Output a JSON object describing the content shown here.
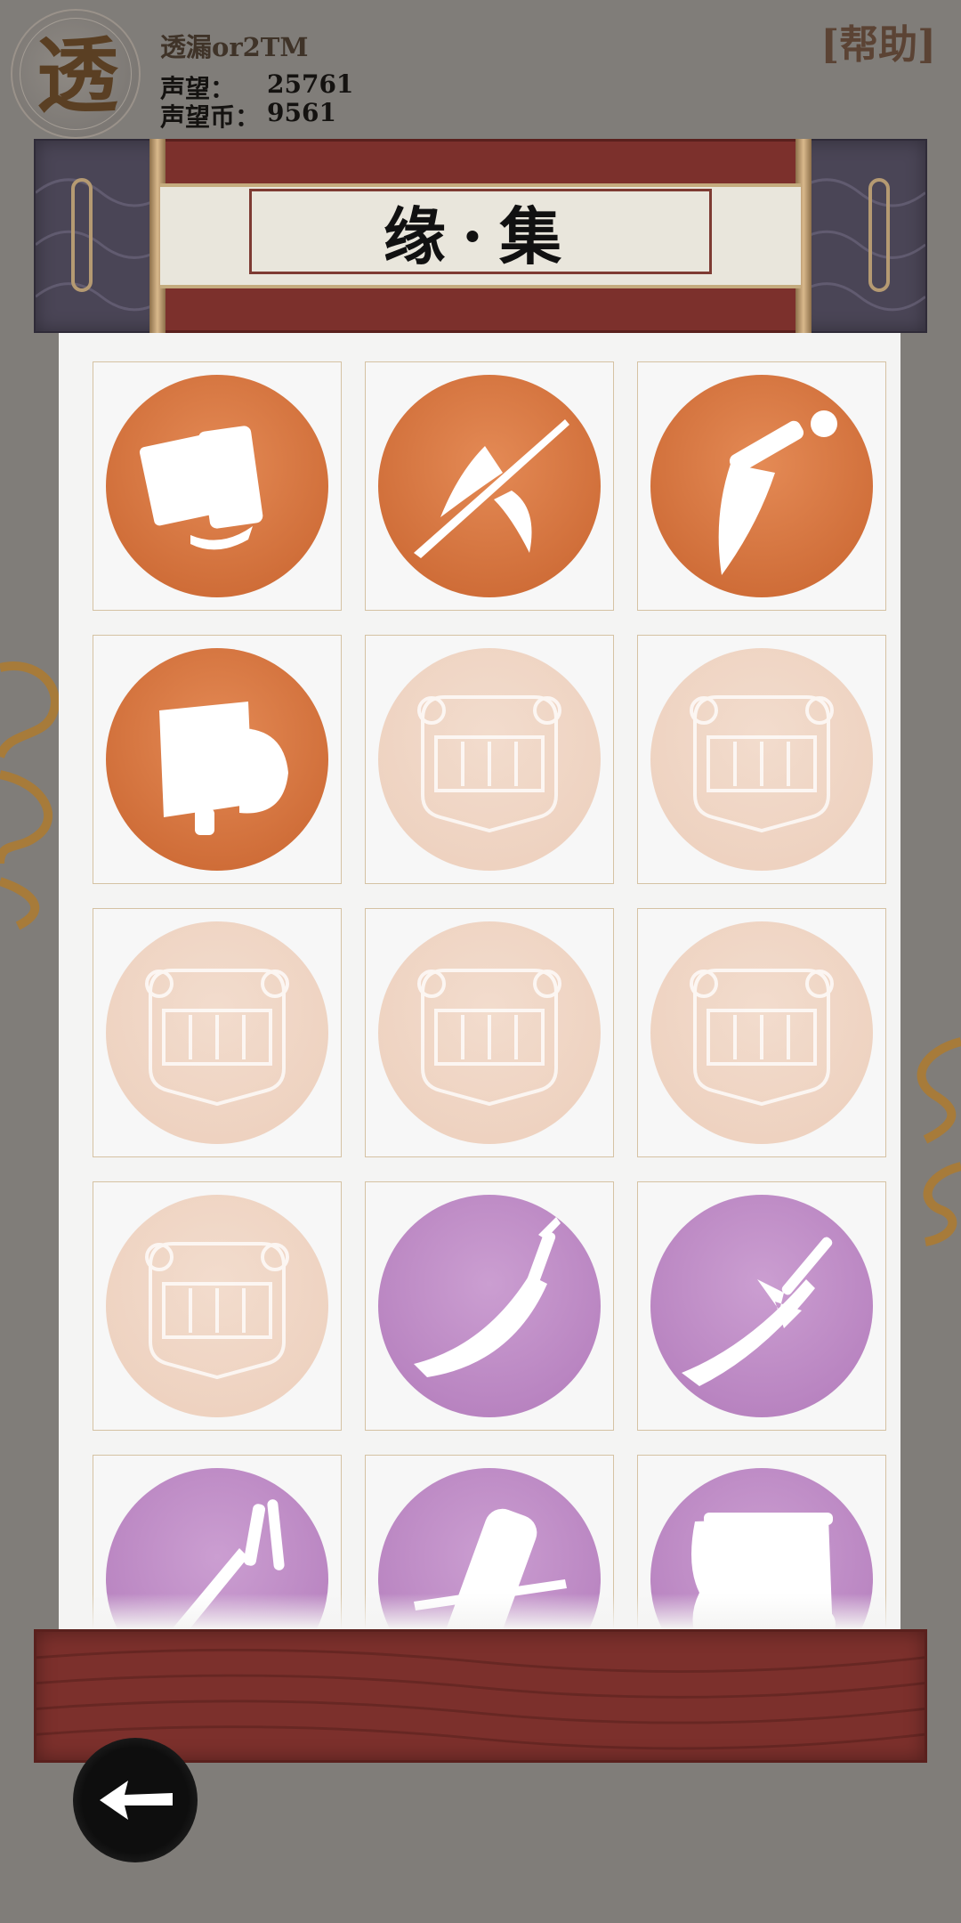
{
  "player": {
    "avatar_glyph": "透",
    "name": "透漏or2TM",
    "reputation_label": "声望：",
    "reputation_value": "25761",
    "coin_label": "声望币：",
    "coin_value": "9561"
  },
  "header": {
    "help_label": "[帮助]"
  },
  "title": "缘·集",
  "colors": {
    "background": "#807d79",
    "scroll_red": "#7c302c",
    "scroll_wing": "#4a4556",
    "orange": "#d9733d",
    "faded": "#f0d6c5",
    "purple": "#c08dc8"
  },
  "items": [
    {
      "name": "scroll-book-item",
      "state": "orange",
      "icon": "book-scroll"
    },
    {
      "name": "halberd-item",
      "state": "orange",
      "icon": "halberd"
    },
    {
      "name": "curved-dagger-item",
      "state": "orange",
      "icon": "curved-dagger"
    },
    {
      "name": "bamboo-book-item",
      "state": "orange",
      "icon": "bamboo-book"
    },
    {
      "name": "locked-item-5",
      "state": "faded",
      "icon": "lock-seal"
    },
    {
      "name": "locked-item-6",
      "state": "faded",
      "icon": "lock-seal"
    },
    {
      "name": "locked-item-7",
      "state": "faded",
      "icon": "lock-seal"
    },
    {
      "name": "locked-item-8",
      "state": "faded",
      "icon": "lock-seal"
    },
    {
      "name": "locked-item-9",
      "state": "faded",
      "icon": "lock-seal"
    },
    {
      "name": "locked-item-10",
      "state": "faded",
      "icon": "lock-seal"
    },
    {
      "name": "broadsword-item",
      "state": "purple",
      "icon": "broadsword"
    },
    {
      "name": "serrated-spear-item",
      "state": "purple",
      "icon": "serrated-spear"
    },
    {
      "name": "nunchaku-sword-item",
      "state": "purple",
      "icon": "sword-whip"
    },
    {
      "name": "rolled-scroll-item",
      "state": "purple",
      "icon": "rolled-scroll"
    },
    {
      "name": "unrolled-scroll-item",
      "state": "purple",
      "icon": "unrolled-scroll"
    }
  ],
  "back_button": {
    "icon": "back-arrow-icon"
  }
}
